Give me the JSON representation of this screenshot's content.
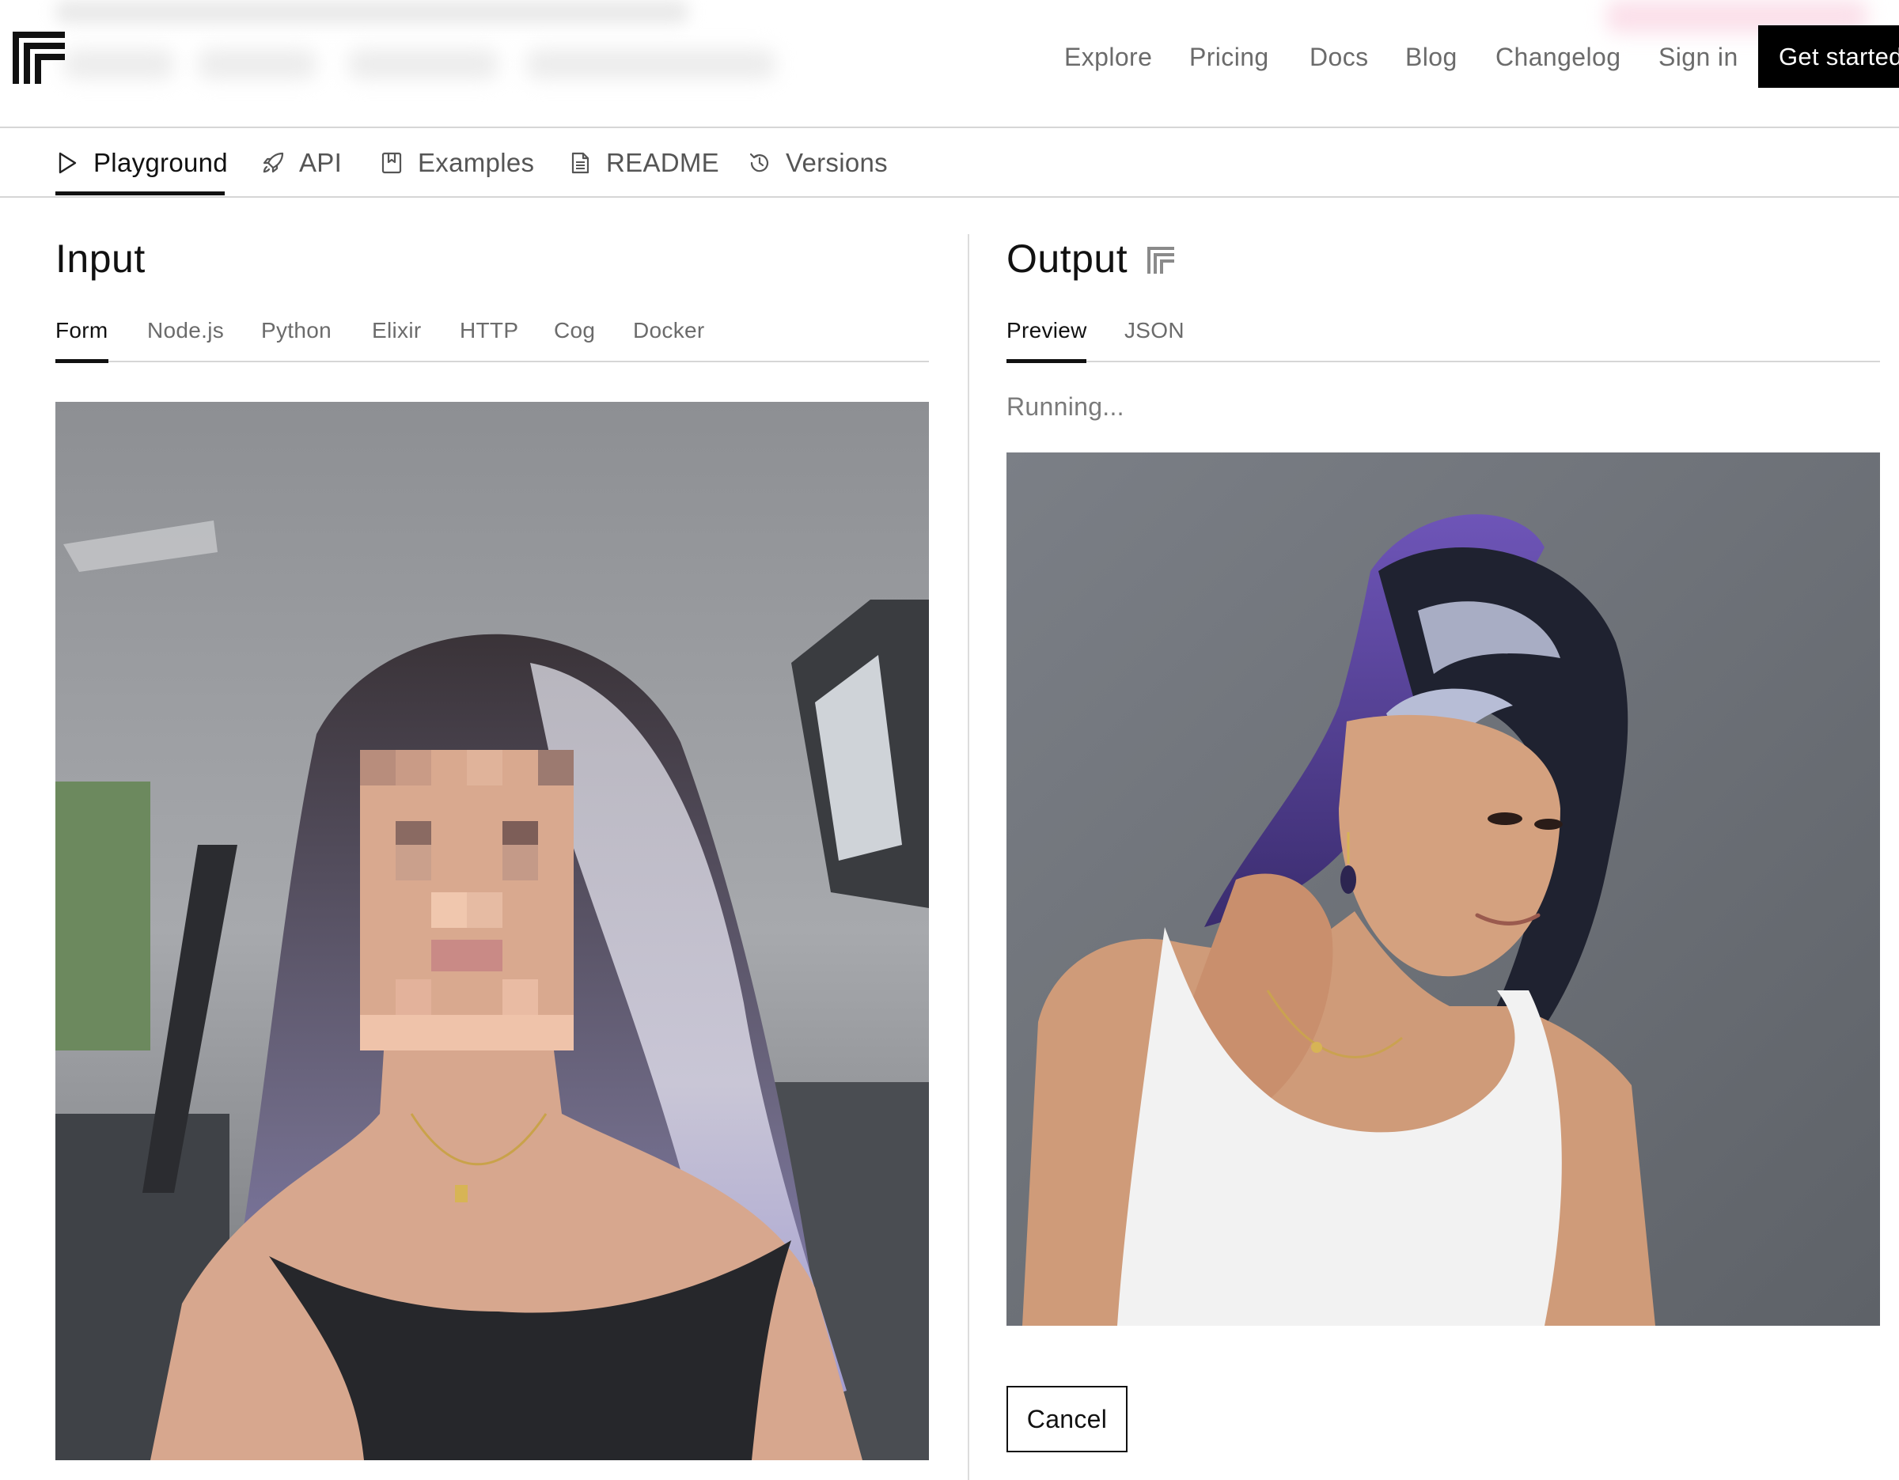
{
  "header": {
    "nav": [
      "Explore",
      "Pricing",
      "Docs",
      "Blog",
      "Changelog",
      "Sign in"
    ],
    "cta_label": "Get started"
  },
  "subnav": {
    "tabs": [
      {
        "label": "Playground",
        "icon": "play-icon",
        "active": true
      },
      {
        "label": "API",
        "icon": "rocket-icon",
        "active": false
      },
      {
        "label": "Examples",
        "icon": "bookmark-icon",
        "active": false
      },
      {
        "label": "README",
        "icon": "document-icon",
        "active": false
      },
      {
        "label": "Versions",
        "icon": "history-icon",
        "active": false
      }
    ]
  },
  "input": {
    "title": "Input",
    "tabs": [
      "Form",
      "Node.js",
      "Python",
      "Elixir",
      "HTTP",
      "Cog",
      "Docker"
    ],
    "active_tab": "Form"
  },
  "output": {
    "title": "Output",
    "tabs": [
      "Preview",
      "JSON"
    ],
    "active_tab": "Preview",
    "status": "Running...",
    "cancel_label": "Cancel"
  },
  "colors": {
    "accent": "#000000",
    "muted_text": "#6b6b6b",
    "border": "#d6d6d6"
  }
}
